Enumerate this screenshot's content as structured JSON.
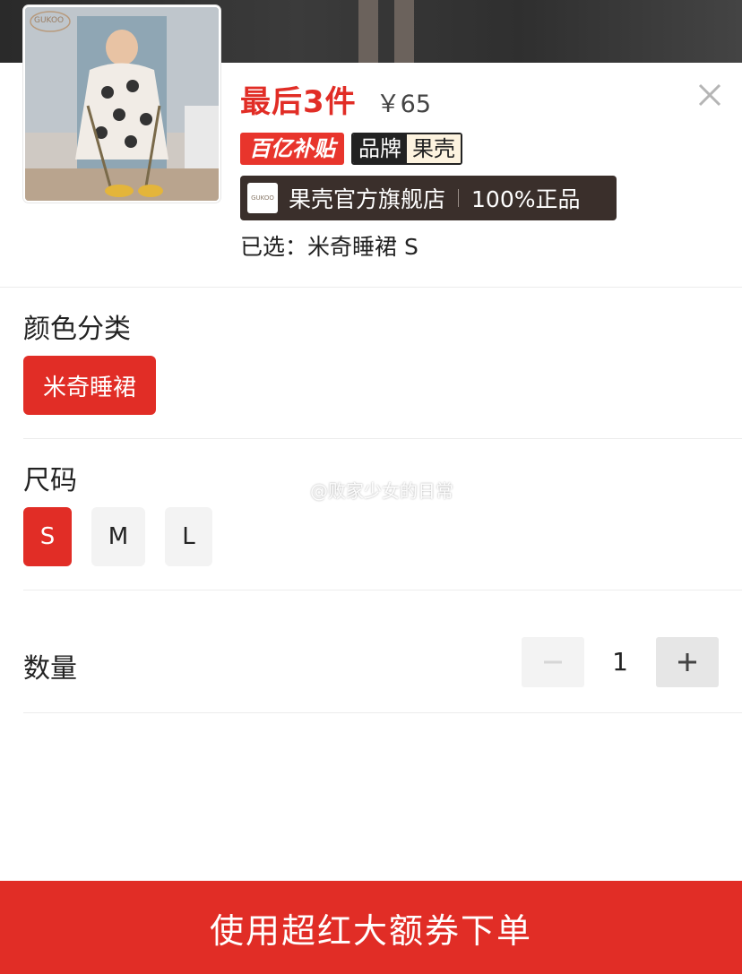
{
  "product": {
    "stock_label": "最后3件",
    "price": "￥65",
    "thumb_logo_text": "GUKOO"
  },
  "badges": {
    "subsidy": "百亿补贴",
    "brand_key": "品牌",
    "brand_value": "果壳"
  },
  "store": {
    "logo_text": "GUKOO",
    "name": "果壳官方旗舰店",
    "authenticity": "100%正品"
  },
  "selected_text": "已选：米奇睡裙 S",
  "color_section": {
    "title": "颜色分类",
    "options": [
      {
        "label": "米奇睡裙",
        "selected": true
      }
    ]
  },
  "size_section": {
    "title": "尺码",
    "options": [
      {
        "label": "S",
        "selected": true
      },
      {
        "label": "M",
        "selected": false
      },
      {
        "label": "L",
        "selected": false
      }
    ]
  },
  "quantity": {
    "title": "数量",
    "value": "1",
    "decrement_icon": "minus-icon",
    "increment_icon": "plus-icon"
  },
  "watermark": "@败家少女的日常",
  "cta_label": "使用超红大额券下单",
  "colors": {
    "accent_red": "#e12d26",
    "store_bg": "#3a2f2b",
    "chip_idle": "#f3f3f3"
  }
}
